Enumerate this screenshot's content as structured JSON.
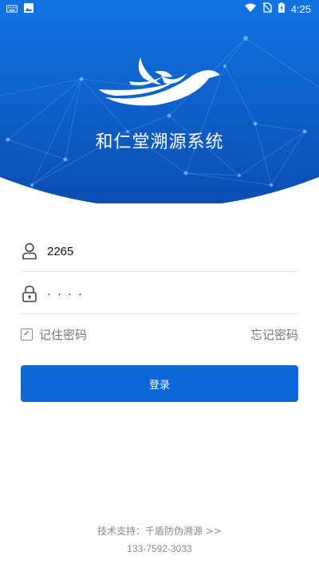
{
  "status_bar": {
    "time": "4:25",
    "icons": [
      "keyboard-icon",
      "image-icon",
      "wifi-icon",
      "no-sim-icon",
      "battery-icon"
    ]
  },
  "header": {
    "app_title": "和仁堂溯源系统",
    "background_colors": [
      "#0f6fe0",
      "#0a4fb5"
    ],
    "logo": "bird-logo"
  },
  "login_form": {
    "username": {
      "icon": "user-icon",
      "value": "2265"
    },
    "password": {
      "icon": "lock-icon",
      "masked_value": "····"
    },
    "remember_label": "记住密码",
    "remember_checked": true,
    "forgot_label": "忘记密码",
    "submit_label": "登录",
    "accent_color": "#0b66d6"
  },
  "footer": {
    "support_text": "技术支持：千盾防伪溯源 >>",
    "phone": "133-7592-3033"
  }
}
